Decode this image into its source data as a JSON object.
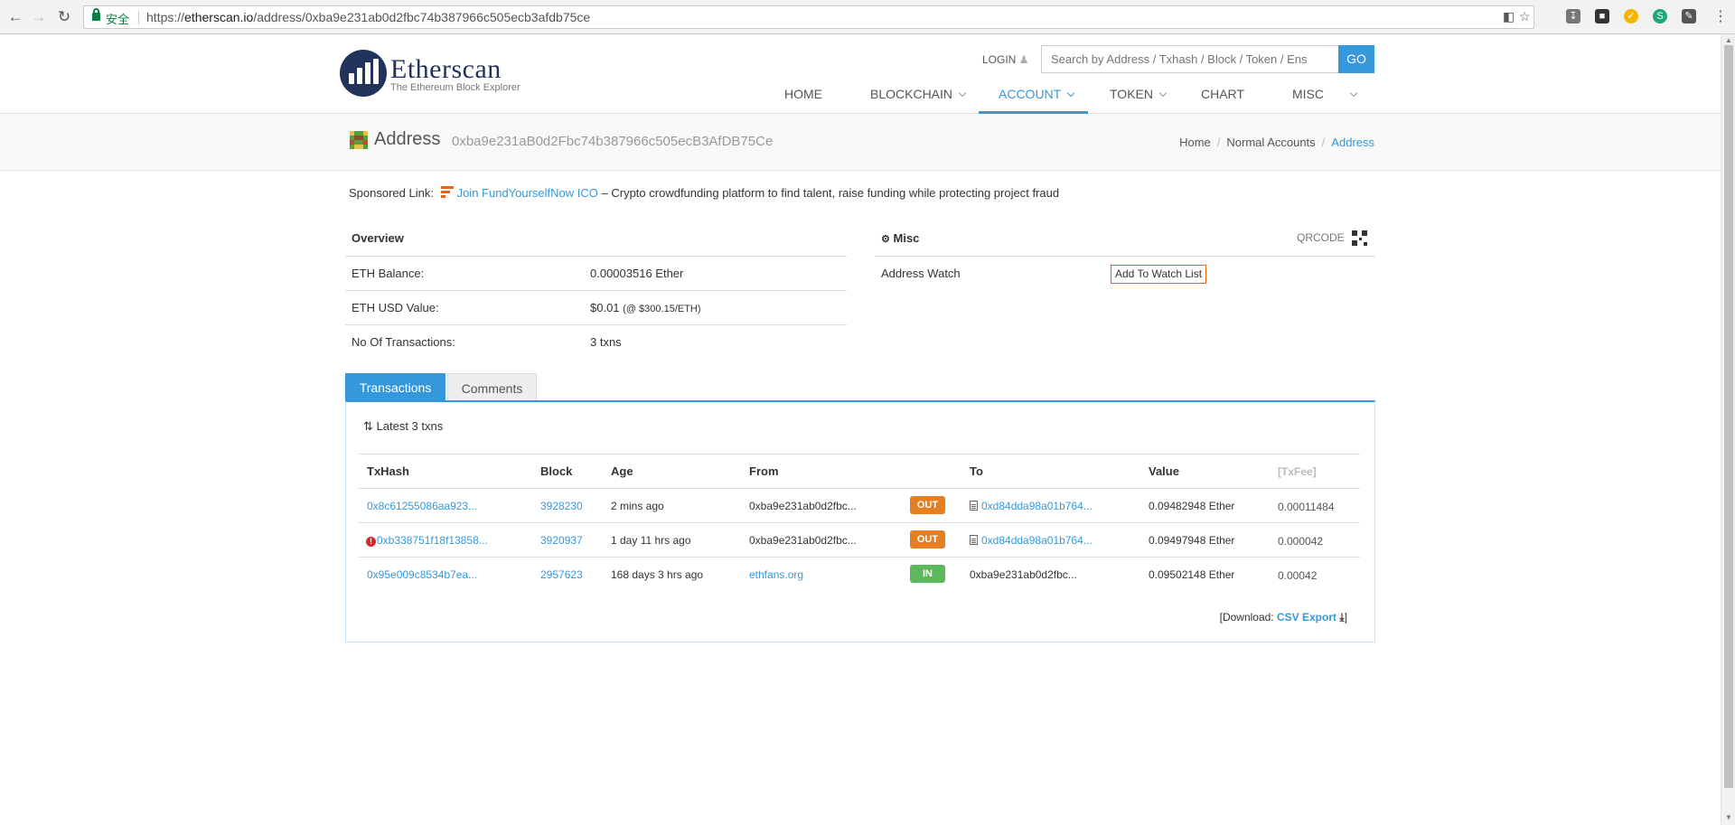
{
  "browser": {
    "secure_label": "安全",
    "url_prefix": "https://",
    "url_host": "etherscan.io",
    "url_path": "/address/0xba9e231ab0d2fbc74b387966c505ecb3afdb75ce"
  },
  "header": {
    "logo_name": "Etherscan",
    "logo_tagline": "The Ethereum Block Explorer",
    "login_label": "LOGIN",
    "search_placeholder": "Search by Address / Txhash / Block / Token / Ens",
    "go_label": "GO",
    "menu": [
      "HOME",
      "BLOCKCHAIN",
      "ACCOUNT",
      "TOKEN",
      "CHART",
      "MISC"
    ],
    "active_menu": "ACCOUNT"
  },
  "page": {
    "title": "Address",
    "address": "0xba9e231aB0d2Fbc74b387966c505ecB3AfDB75Ce",
    "breadcrumb": [
      "Home",
      "Normal Accounts",
      "Address"
    ]
  },
  "sponsored": {
    "prefix": "Sponsored Link:",
    "link_text": "Join FundYourselfNow ICO",
    "description": " – Crypto crowdfunding platform to find talent, raise funding while protecting project fraud"
  },
  "overview": {
    "title": "Overview",
    "rows": [
      {
        "label": "ETH Balance:",
        "value": "0.00003516 Ether"
      },
      {
        "label": "ETH USD Value:",
        "value": "$0.01",
        "extra": "(@ $300.15/ETH)"
      },
      {
        "label": "No Of Transactions:",
        "value": "3 txns"
      }
    ]
  },
  "misc": {
    "title": "Misc",
    "qrcode_label": "QRCODE",
    "watch_label": "Address Watch",
    "watch_button": "Add To Watch List"
  },
  "tabs": [
    "Transactions",
    "Comments"
  ],
  "transactions": {
    "latest_label": "Latest 3 txns",
    "columns": [
      "TxHash",
      "Block",
      "Age",
      "From",
      "To",
      "Value",
      "[TxFee]"
    ],
    "rows": [
      {
        "hash": "0x8c61255086aa923...",
        "block": "3928230",
        "age": "2 mins ago",
        "from": "0xba9e231ab0d2fbc...",
        "direction": "OUT",
        "to": "0xd84dda98a01b764...",
        "value": "0.09482948 Ether",
        "fee": "0.00011484"
      },
      {
        "hash": "0xb338751f18f13858...",
        "block": "3920937",
        "age": "1 day 11 hrs ago",
        "from": "0xba9e231ab0d2fbc...",
        "direction": "OUT",
        "to": "0xd84dda98a01b764...",
        "value": "0.09497948 Ether",
        "fee": "0.000042"
      },
      {
        "hash": "0x95e009c8534b7ea...",
        "block": "2957623",
        "age": "168 days 3 hrs ago",
        "from": "ethfans.org",
        "direction": "IN",
        "to": "0xba9e231ab0d2fbc...",
        "value": "0.09502148 Ether",
        "fee": "0.00042"
      }
    ],
    "download_prefix": "[Download: ",
    "download_link": "CSV Export",
    "download_suffix": "]"
  },
  "colors": {
    "accent": "#3498db",
    "out_badge": "#e67e22",
    "in_badge": "#5cb85c",
    "brand": "#21325b"
  }
}
